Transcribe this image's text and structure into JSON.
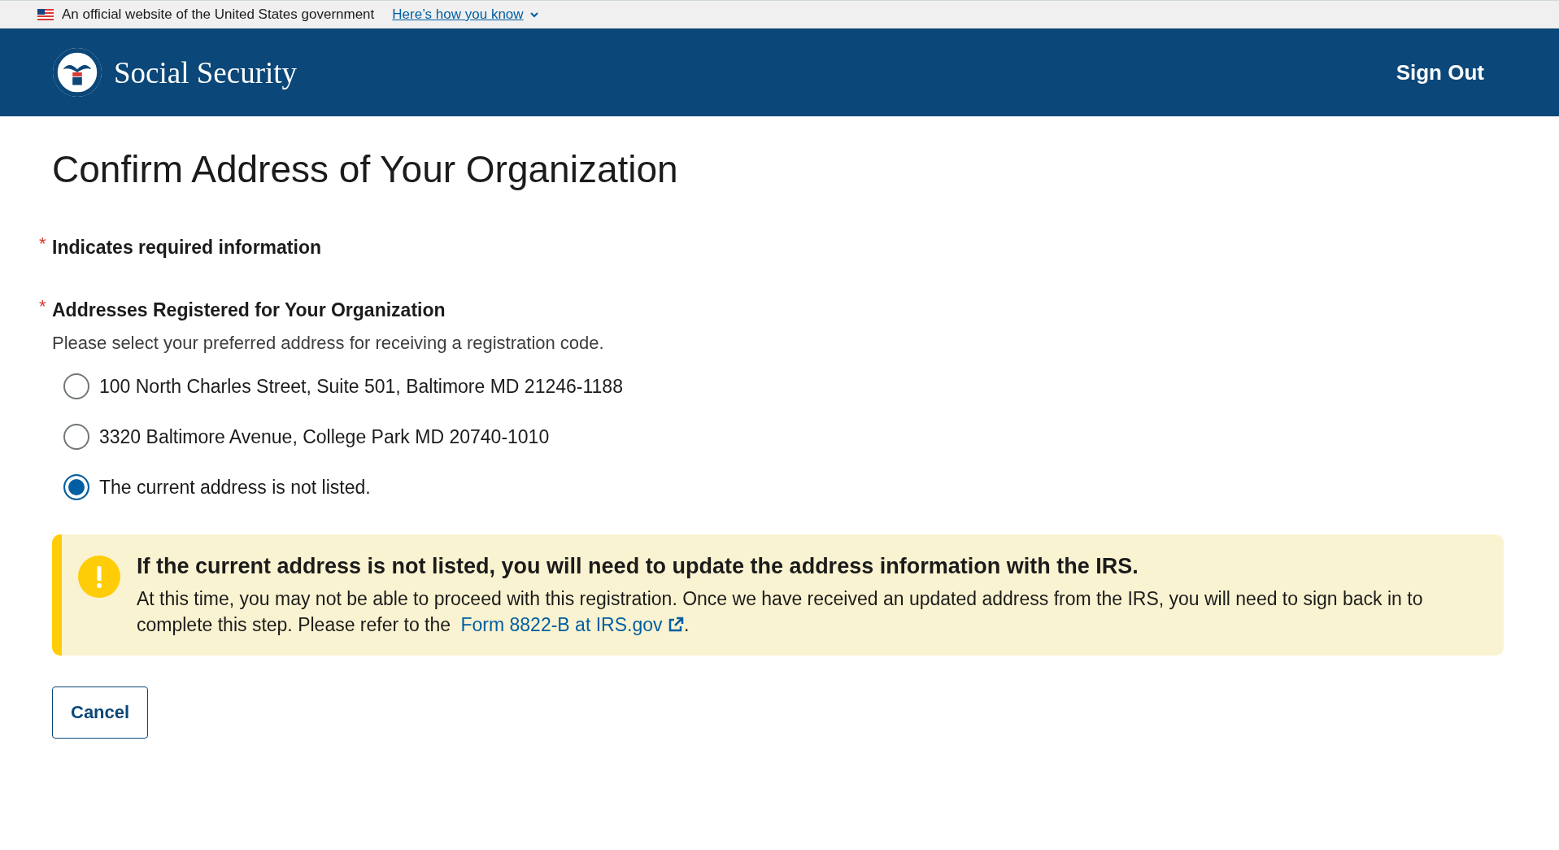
{
  "gov_banner": {
    "text": "An official website of the United States government",
    "link": "Here’s how you know"
  },
  "header": {
    "title": "Social Security",
    "sign_out": "Sign Out"
  },
  "page_title": "Confirm Address of Your Organization",
  "required_note": {
    "mark": "*",
    "text": "Indicates required information"
  },
  "address_group": {
    "mark": "*",
    "label": "Addresses Registered for Your Organization",
    "hint": "Please select your preferred address for receiving a registration code.",
    "options": [
      {
        "label": "100 North Charles Street, Suite 501, Baltimore MD 21246-1188",
        "selected": false
      },
      {
        "label": "3320 Baltimore Avenue, College Park MD 20740-1010",
        "selected": false
      },
      {
        "label": "The current address is not listed.",
        "selected": true
      }
    ]
  },
  "alert": {
    "heading": "If the current address is not listed, you will need to update the address information with the IRS.",
    "body": "At this time, you may not be able to proceed with this registration. Once we have received an updated address from the IRS, you will need to sign back in to complete this step. Please refer to the ",
    "link": "Form 8822-B at IRS.gov",
    "body_end": "."
  },
  "buttons": [
    "Cancel"
  ]
}
